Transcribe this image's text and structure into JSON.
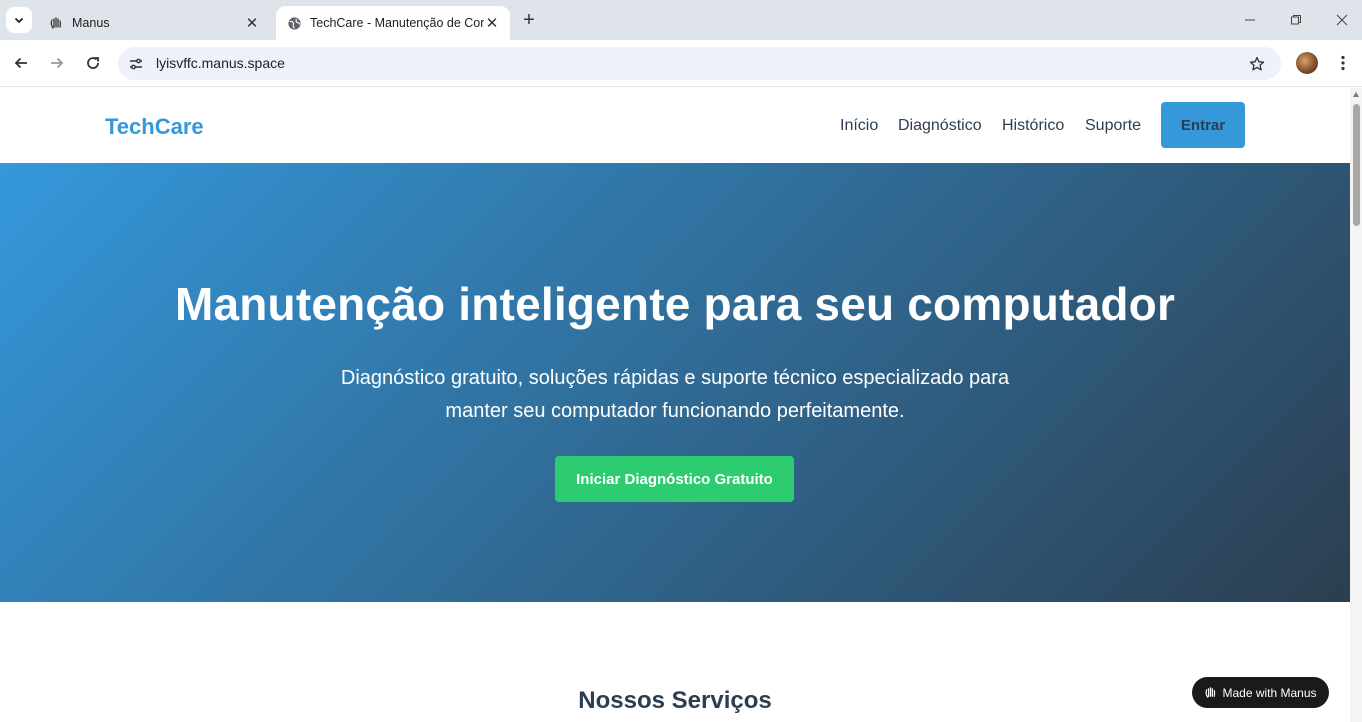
{
  "browser": {
    "tabs": [
      {
        "title": "Manus",
        "active": false
      },
      {
        "title": "TechCare - Manutenção de Computadores",
        "active": true
      }
    ],
    "url": "lyisvffc.manus.space"
  },
  "site": {
    "logo": "TechCare",
    "nav": [
      "Início",
      "Diagnóstico",
      "Histórico",
      "Suporte"
    ],
    "login_label": "Entrar"
  },
  "hero": {
    "title": "Manutenção inteligente para seu computador",
    "subtitle": "Diagnóstico gratuito, soluções rápidas e suporte técnico especializado para manter seu computador funcionando perfeitamente.",
    "cta": "Iniciar Diagnóstico Gratuito"
  },
  "services": {
    "title": "Nossos Serviços"
  },
  "badge": {
    "label": "Made with Manus"
  },
  "colors": {
    "brand": "#3498db",
    "dark": "#2c3e50",
    "cta": "#2ecc71"
  }
}
